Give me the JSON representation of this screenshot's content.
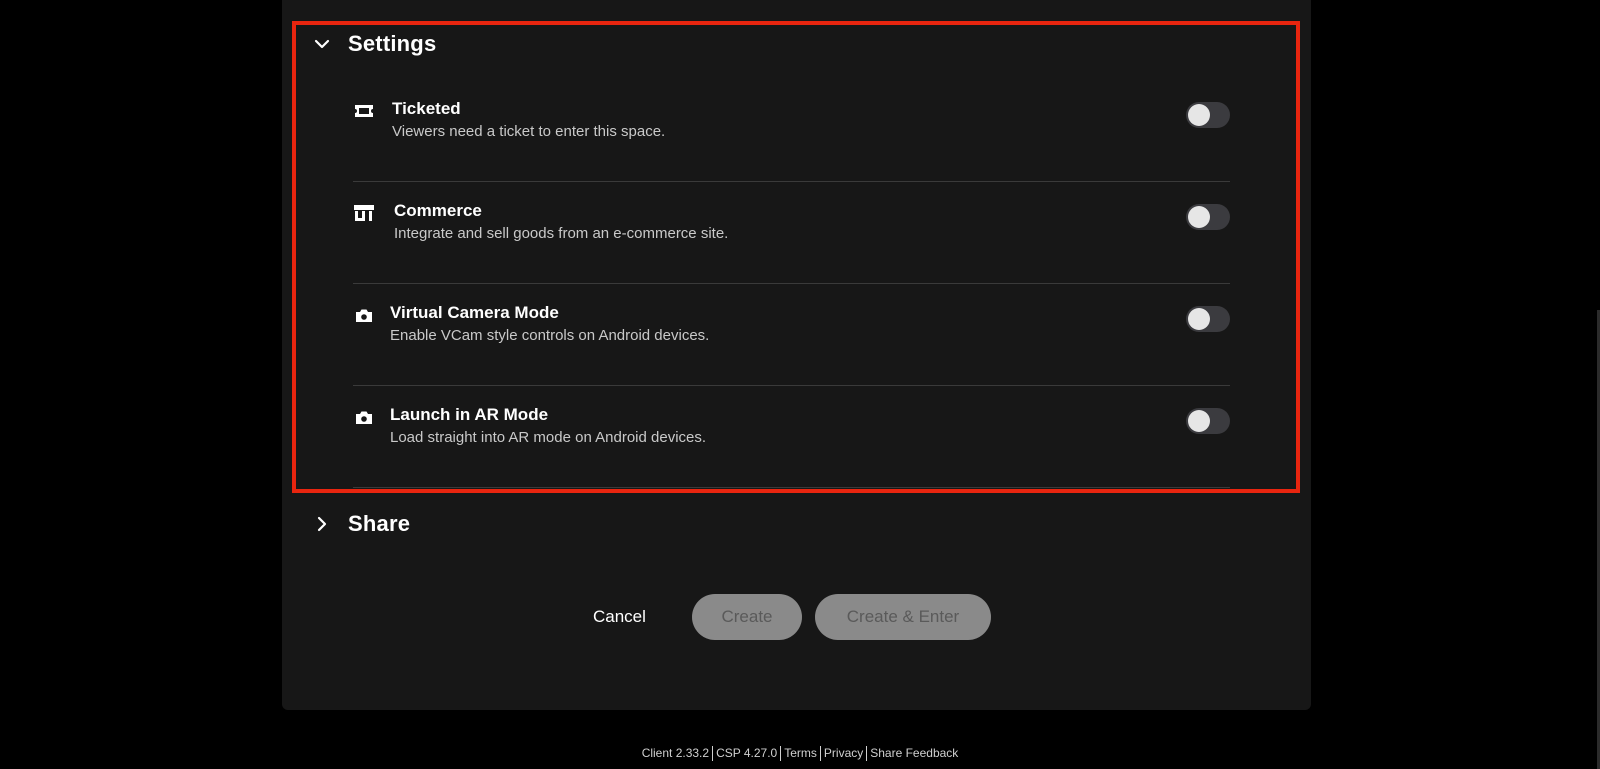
{
  "settings_section": {
    "title": "Settings",
    "items": [
      {
        "icon": "ticket-icon",
        "label": "Ticketed",
        "description": "Viewers need a ticket to enter this space.",
        "enabled": false
      },
      {
        "icon": "storefront-icon",
        "label": "Commerce",
        "description": "Integrate and sell goods from an e-commerce site.",
        "enabled": false
      },
      {
        "icon": "camera-icon",
        "label": "Virtual Camera Mode",
        "description": "Enable VCam style controls on Android devices.",
        "enabled": false
      },
      {
        "icon": "camera-icon",
        "label": "Launch in AR Mode",
        "description": "Load straight into AR mode on Android devices.",
        "enabled": false
      }
    ]
  },
  "share_section": {
    "title": "Share"
  },
  "actions": {
    "cancel_label": "Cancel",
    "create_label": "Create",
    "create_enter_label": "Create & Enter"
  },
  "footer": {
    "client_version": "Client 2.33.2",
    "csp_version": "CSP 4.27.0",
    "terms": "Terms",
    "privacy": "Privacy",
    "feedback": "Share Feedback"
  },
  "colors": {
    "highlight": "#e8250f",
    "panel": "#171717",
    "button_disabled": "#8a8a8a",
    "toggle_off": "#3b3b3f"
  }
}
